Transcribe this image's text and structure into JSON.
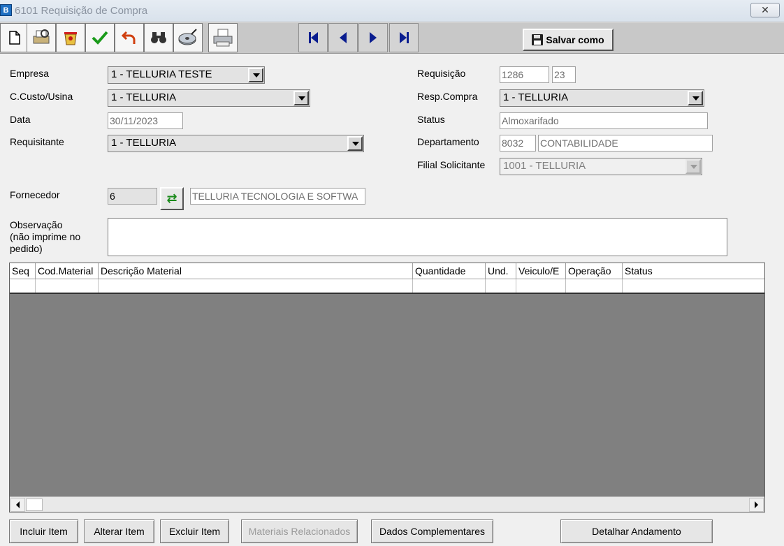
{
  "window": {
    "title": "6101 Requisição de Compra",
    "close_symbol": "✕",
    "app_icon_letter": "B"
  },
  "toolbar": {
    "icons": [
      "new-icon",
      "print-preview-icon",
      "delete-icon",
      "confirm-check-icon",
      "undo-icon",
      "search-binoculars-icon",
      "disk-icon",
      "printer-icon"
    ],
    "nav": [
      "first-record-icon",
      "previous-record-icon",
      "next-record-icon",
      "last-record-icon"
    ],
    "save_as_label": "Salvar como"
  },
  "form": {
    "empresa_label": "Empresa",
    "empresa_value": "1 - TELLURIA TESTE",
    "ccusto_label": "C.Custo/Usina",
    "ccusto_value": "1 - TELLURIA",
    "data_label": "Data",
    "data_value": "30/11/2023",
    "requisitante_label": "Requisitante",
    "requisitante_value": "1 - TELLURIA",
    "requisicao_label": "Requisição",
    "requisicao_value": "1286",
    "requisicao_seq": "23",
    "resp_compra_label": "Resp.Compra",
    "resp_compra_value": "1 - TELLURIA",
    "status_label": "Status",
    "status_value": "Almoxarifado",
    "departamento_label": "Departamento",
    "departamento_code": "8032",
    "departamento_name": "CONTABILIDADE",
    "filial_label": "Filial Solicitante",
    "filial_value": "1001 - TELLURIA",
    "fornecedor_label": "Fornecedor",
    "fornecedor_code": "6",
    "fornecedor_name": "TELLURIA TECNOLOGIA E SOFTWA",
    "observacao_label": "Observação\n(não imprime no\npedido)",
    "observacao_value": ""
  },
  "grid": {
    "columns": [
      "Seq",
      "Cod.Material",
      "Descrição Material",
      "Quantidade",
      "Und.",
      "Veiculo/E",
      "Operação",
      "Status"
    ],
    "rows": []
  },
  "buttons": {
    "incluir": "Incluir Item",
    "alterar": "Alterar Item",
    "excluir": "Excluir Item",
    "materiais": "Materiais Relacionados",
    "dados": "Dados Complementares",
    "detalhar": "Detalhar Andamento"
  }
}
